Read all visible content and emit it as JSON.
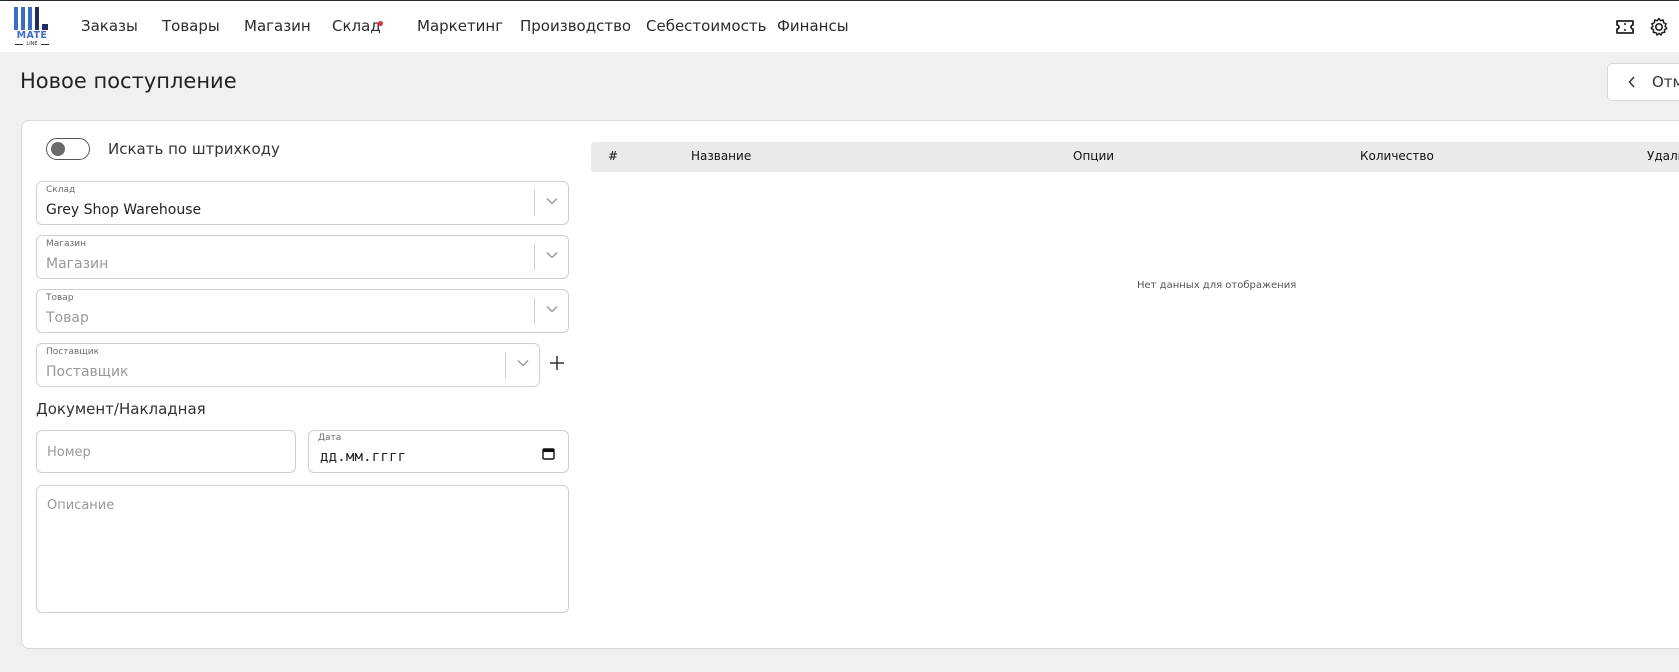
{
  "logo": {
    "name": "MATE",
    "sub": "LINE"
  },
  "nav": {
    "items": [
      "Заказы",
      "Товары",
      "Магазин",
      "Склад",
      "Маркетинг",
      "Производство",
      "Себестоимость",
      "Финансы"
    ]
  },
  "top_icons": [
    "ticket-icon",
    "gear-icon"
  ],
  "page": {
    "title": "Новое поступление",
    "cancel_label": "Отмена"
  },
  "form": {
    "barcode_toggle_label": "Искать по штрихкоду",
    "barcode_toggle_on": false,
    "warehouse": {
      "label": "Склад",
      "value": "Grey Shop Warehouse"
    },
    "shop": {
      "label": "Магазин",
      "placeholder": "Магазин"
    },
    "product": {
      "label": "Товар",
      "placeholder": "Товар"
    },
    "supplier": {
      "label": "Поставщик",
      "placeholder": "Поставщик"
    },
    "document_section": "Документ/Накладная",
    "number": {
      "placeholder": "Номер"
    },
    "date": {
      "label": "Дата",
      "value": "дд.мм.гггг"
    },
    "description": {
      "placeholder": "Описание"
    }
  },
  "table": {
    "columns": [
      "#",
      "Название",
      "Опции",
      "Количество",
      "Удалить"
    ],
    "empty_text": "Нет данных для отображения"
  },
  "colors": {
    "accent": "#3d6cc6",
    "notification_dot": "#e0303a",
    "background": "#f0f0f0"
  }
}
